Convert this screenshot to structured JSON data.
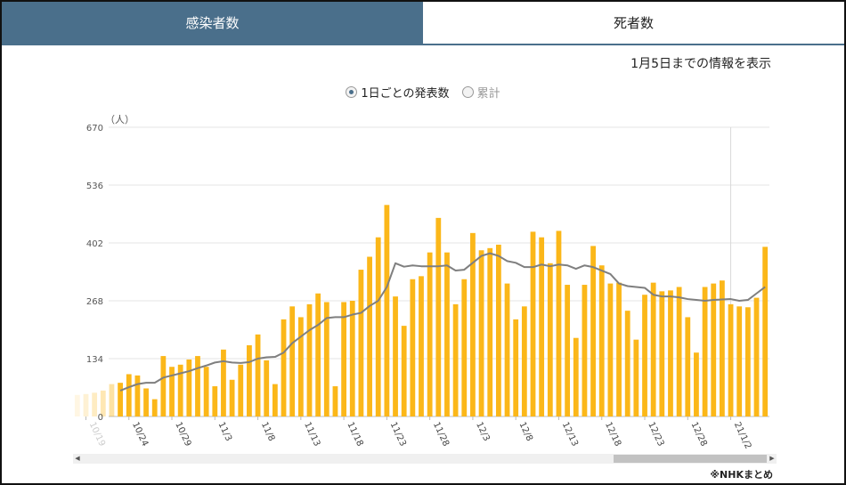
{
  "tabs": [
    {
      "label": "感染者数",
      "active": true
    },
    {
      "label": "死者数",
      "active": false
    }
  ],
  "info_note": "1月5日までの情報を表示",
  "radios": [
    {
      "label": "1日ごとの発表数",
      "checked": true
    },
    {
      "label": "累計",
      "checked": false
    }
  ],
  "source": "※NHKまとめ",
  "colors": {
    "accent": "#4a6f8b",
    "bar": "#fbb719",
    "line": "#7f7f7f"
  },
  "chart_data": {
    "type": "bar",
    "ylabel": "（人）",
    "ylim": [
      0,
      670
    ],
    "yticks": [
      0,
      134,
      268,
      402,
      536,
      670
    ],
    "grid": true,
    "start_date": "2020-10-18",
    "x_tick_labels": [
      {
        "index": 1,
        "label": "10/19"
      },
      {
        "index": 6,
        "label": "10/24"
      },
      {
        "index": 11,
        "label": "10/29"
      },
      {
        "index": 16,
        "label": "11/3"
      },
      {
        "index": 21,
        "label": "11/8"
      },
      {
        "index": 26,
        "label": "11/13"
      },
      {
        "index": 31,
        "label": "11/18"
      },
      {
        "index": 36,
        "label": "11/23"
      },
      {
        "index": 41,
        "label": "11/28"
      },
      {
        "index": 46,
        "label": "12/3"
      },
      {
        "index": 51,
        "label": "12/8"
      },
      {
        "index": 56,
        "label": "12/13"
      },
      {
        "index": 61,
        "label": "12/18"
      },
      {
        "index": 66,
        "label": "12/23"
      },
      {
        "index": 71,
        "label": "12/28"
      },
      {
        "index": 76,
        "label": "21/1/2"
      }
    ],
    "faded_leading_bars": 5,
    "series": [
      {
        "values": [
          50,
          52,
          55,
          60,
          75,
          78,
          98,
          95,
          65,
          40,
          140,
          115,
          120,
          132,
          140,
          115,
          70,
          155,
          85,
          120,
          165,
          190,
          130,
          75,
          225,
          255,
          230,
          260,
          285,
          265,
          70,
          265,
          268,
          340,
          370,
          415,
          490,
          278,
          210,
          318,
          325,
          380,
          460,
          380,
          260,
          318,
          425,
          385,
          390,
          398,
          308,
          225,
          255,
          428,
          415,
          355,
          430,
          305,
          182,
          305,
          395,
          350,
          308,
          310,
          245,
          178,
          282,
          310,
          290,
          292,
          300,
          230,
          148,
          300,
          308,
          315,
          260,
          255,
          253,
          275,
          393
        ]
      },
      {
        "values": [
          null,
          null,
          null,
          null,
          null,
          60,
          68,
          75,
          78,
          78,
          90,
          95,
          100,
          105,
          112,
          118,
          125,
          128,
          125,
          124,
          126,
          134,
          137,
          138,
          148,
          170,
          185,
          200,
          212,
          228,
          230,
          230,
          236,
          240,
          256,
          268,
          300,
          355,
          347,
          350,
          348,
          348,
          348,
          350,
          338,
          340,
          356,
          372,
          378,
          372,
          360,
          356,
          346,
          346,
          352,
          348,
          352,
          350,
          342,
          350,
          346,
          338,
          330,
          308,
          302,
          300,
          298,
          282,
          278,
          278,
          276,
          272,
          270,
          268,
          270,
          271,
          272,
          268,
          270,
          285,
          300
        ]
      }
    ]
  }
}
